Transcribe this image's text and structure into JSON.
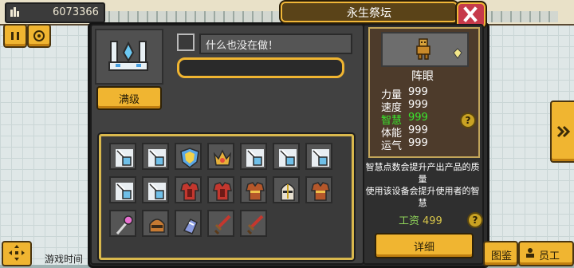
{
  "hud": {
    "money_icon": "cash-icon",
    "money_value": "6073366",
    "pause_icon": "pause-icon",
    "speed_icon": "speed-icon",
    "game_time_label": "游戏时间",
    "move_icon": "move-arrows-icon",
    "side_arrow_icon": "double-chevron-right-icon",
    "bottom_right": {
      "btn1_label": "图鉴",
      "btn2_label": "员工"
    }
  },
  "dialog": {
    "title": "永生祭坛",
    "close_icon": "close-x-icon",
    "altar_icon": "altar-icon",
    "max_level_button": "满级",
    "status_checkbox_checked": false,
    "status_text": "什么也没在做！",
    "progress_fraction": 0,
    "inventory": [
      [
        "potion-vial-icon",
        "potion-vial-icon",
        "crest-shield-icon",
        "gold-crown-icon",
        "potion-vial-icon",
        "potion-vial-icon",
        "potion-vial-icon"
      ],
      [
        "potion-vial-icon",
        "potion-vial-icon",
        "red-armor-icon",
        "red-armor-icon",
        "brown-armor-icon",
        "knight-helmet-icon",
        "brown-armor-icon"
      ],
      [
        "magic-staff-icon",
        "bronze-helmet-icon",
        "blue-gauntlet-icon",
        "red-sword-icon",
        "red-sword-icon"
      ]
    ]
  },
  "profile": {
    "portrait_icon": "golden-idol-icon",
    "badge_icon": "small-gem-icon",
    "name": "阵眼",
    "stats": [
      {
        "label": "力量",
        "value": "999",
        "color": "#ffffff"
      },
      {
        "label": "速度",
        "value": "999",
        "color": "#ffffff"
      },
      {
        "label": "智慧",
        "value": "999",
        "color": "#39e62d"
      },
      {
        "label": "体能",
        "value": "999",
        "color": "#ffffff"
      },
      {
        "label": "运气",
        "value": "999",
        "color": "#ffffff"
      }
    ],
    "help_icon": "question-icon",
    "description_line1": "智慧点数会提升产出产品的质量",
    "description_line2": "使用该设备会提升使用者的智慧",
    "wage_label": "工资",
    "wage_value": "499",
    "detail_button": "详细"
  },
  "colors": {
    "accent_gold": "#f0b531",
    "highlight_green": "#39e62d",
    "close_red": "#c63a4a"
  }
}
